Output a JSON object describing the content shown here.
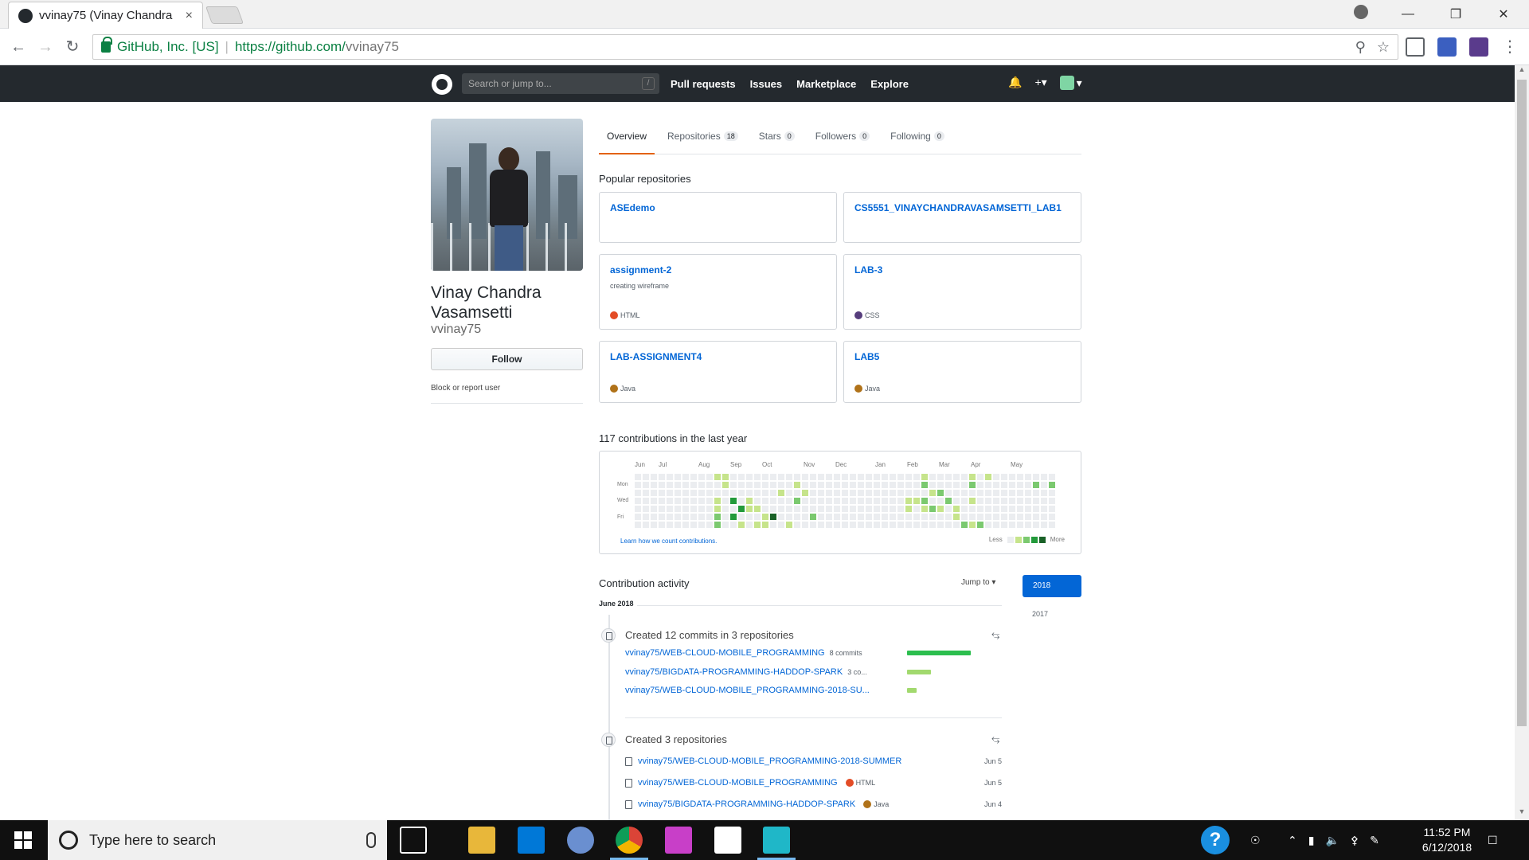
{
  "browser": {
    "tab_title": "vvinay75 (Vinay Chandra",
    "tab_close": "×",
    "secure_label": "GitHub, Inc. [US]",
    "url_host": "https://github.com/",
    "url_path": "vvinay75"
  },
  "gh_header": {
    "search_placeholder": "Search or jump to...",
    "search_shortcut": "/",
    "nav": [
      "Pull requests",
      "Issues",
      "Marketplace",
      "Explore"
    ]
  },
  "profile": {
    "full_name": "Vinay Chandra Vasamsetti",
    "username": "vvinay75",
    "follow_label": "Follow",
    "block_label": "Block or report user"
  },
  "tabs": [
    {
      "label": "Overview",
      "count": null,
      "active": true
    },
    {
      "label": "Repositories",
      "count": "18"
    },
    {
      "label": "Stars",
      "count": "0"
    },
    {
      "label": "Followers",
      "count": "0"
    },
    {
      "label": "Following",
      "count": "0"
    }
  ],
  "popular": {
    "heading": "Popular repositories",
    "repos": [
      {
        "name": "ASEdemo",
        "desc": "",
        "lang": "",
        "lang_color": ""
      },
      {
        "name": "CS5551_VINAYCHANDRAVASAMSETTI_LAB1",
        "desc": "",
        "lang": "",
        "lang_color": ""
      },
      {
        "name": "assignment-2",
        "desc": "creating wireframe",
        "lang": "HTML",
        "lang_color": "#e34c26"
      },
      {
        "name": "LAB-3",
        "desc": "",
        "lang": "CSS",
        "lang_color": "#563d7c"
      },
      {
        "name": "LAB-ASSIGNMENT4",
        "desc": "",
        "lang": "Java",
        "lang_color": "#b07219"
      },
      {
        "name": "LAB5",
        "desc": "",
        "lang": "Java",
        "lang_color": "#b07219"
      }
    ]
  },
  "contributions": {
    "heading": "117 contributions in the last year",
    "months": [
      "Jun",
      "Jul",
      "Aug",
      "Sep",
      "Oct",
      "Nov",
      "Dec",
      "Jan",
      "Feb",
      "Mar",
      "Apr",
      "May"
    ],
    "days": [
      "Mon",
      "Wed",
      "Fri"
    ],
    "learn_link": "Learn how we count contributions.",
    "legend_less": "Less",
    "legend_more": "More",
    "colors": [
      "#ebedf0",
      "#c6e48b",
      "#7bc96f",
      "#239a3b",
      "#196127"
    ]
  },
  "activity": {
    "title": "Contribution activity",
    "jump_label": "Jump to ▾",
    "year_active": "2018",
    "year_other": "2017",
    "month_label": "June 2018",
    "commits_head": "Created 12 commits in 3 repositories",
    "commit_rows": [
      {
        "repo": "vvinay75/WEB-CLOUD-MOBILE_PROGRAMMING",
        "count": "8 commits",
        "share": 1.0,
        "color": "#2cbe4e"
      },
      {
        "repo": "vvinay75/BIGDATA-PROGRAMMING-HADDOP-SPARK",
        "count": "3 co...",
        "share": 0.37,
        "color": "#a2d96e"
      },
      {
        "repo": "vvinay75/WEB-CLOUD-MOBILE_PROGRAMMING-2018-SU...",
        "count": "",
        "share": 0.15,
        "color": "#a2d96e"
      }
    ],
    "repos_head": "Created 3 repositories",
    "repo_rows": [
      {
        "repo": "vvinay75/WEB-CLOUD-MOBILE_PROGRAMMING-2018-SUMMER",
        "lang": "",
        "lang_color": "",
        "date": "Jun 5"
      },
      {
        "repo": "vvinay75/WEB-CLOUD-MOBILE_PROGRAMMING",
        "lang": "HTML",
        "lang_color": "#e34c26",
        "date": "Jun 5"
      },
      {
        "repo": "vvinay75/BIGDATA-PROGRAMMING-HADDOP-SPARK",
        "lang": "Java",
        "lang_color": "#b07219",
        "date": "Jun 4"
      }
    ]
  },
  "taskbar": {
    "search_placeholder": "Type here to search",
    "time": "11:52 PM",
    "date": "6/12/2018"
  }
}
